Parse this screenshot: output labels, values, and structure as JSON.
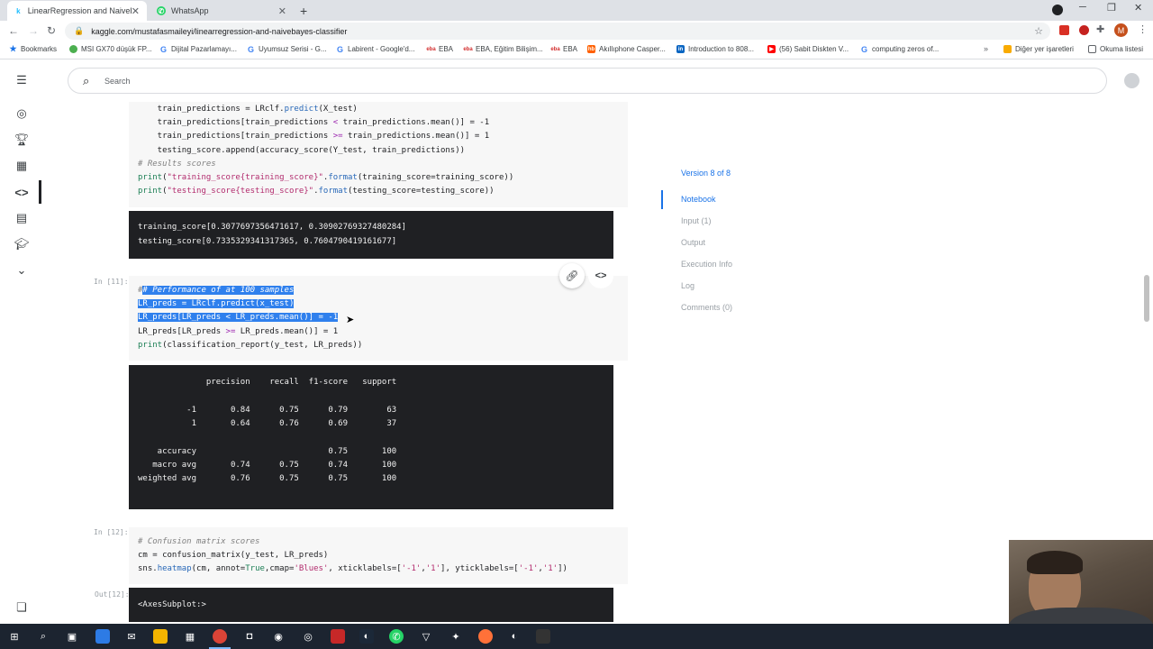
{
  "browser": {
    "tabs": [
      {
        "title": "LinearRegression and NaiveBayes",
        "icon": "kaggle-icon",
        "active": true
      },
      {
        "title": "WhatsApp",
        "icon": "whatsapp-icon",
        "active": false
      }
    ],
    "url": "kaggle.com/mustafasmaileyi/linearregression-and-naivebayes-classifier",
    "bookmarks": [
      {
        "label": "Bookmarks",
        "icon": "star-icon"
      },
      {
        "label": "MSI GX70 düşük FP...",
        "icon": "msi-icon"
      },
      {
        "label": "Dijital Pazarlamayı...",
        "icon": "google-icon"
      },
      {
        "label": "Uyumsuz Serisi - G...",
        "icon": "google-icon"
      },
      {
        "label": "Labirent - Google'd...",
        "icon": "google-icon"
      },
      {
        "label": "EBA",
        "icon": "eba-icon"
      },
      {
        "label": "EBA, Eğitim Bilişim...",
        "icon": "eba-icon"
      },
      {
        "label": "EBA",
        "icon": "eba-icon"
      },
      {
        "label": "Akıllıphone Casper...",
        "icon": "hb-icon"
      },
      {
        "label": "Introduction to 808...",
        "icon": "linkedin-icon"
      },
      {
        "label": "(56) Sabit Diskten V...",
        "icon": "youtube-icon"
      },
      {
        "label": "computing zeros of...",
        "icon": "google-icon"
      }
    ],
    "other_bookmarks": "Diğer yer işaretleri",
    "reading_list": "Okuma listesi",
    "profile_initial": "M"
  },
  "kaggle": {
    "search_placeholder": "Search",
    "cells": {
      "cell10_lines": [
        "    train_predictions = LRclf.predict(X_test)",
        "    train_predictions[train_predictions < train_predictions.mean()] = -1",
        "    train_predictions[train_predictions >= train_predictions.mean()] = 1",
        "    testing_score.append(accuracy_score(Y_test, train_predictions))",
        "# Results scores",
        "print(\"training_score{training_score}\".format(training_score=training_score))",
        "print(\"testing_score{testing_score}\".format(testing_score=testing_score))"
      ],
      "out10_lines": [
        "training_score[0.3077697356471617, 0.30902769327480284]",
        "testing_score[0.7335329341317365, 0.7604790419161677]"
      ],
      "cell11_prompt": "In [11]:",
      "cell11_lines": [
        "# Performance of at 100 samples",
        "LR_preds = LRclf.predict(x_test)",
        "LR_preds[LR_preds < LR_preds.mean()] = -1",
        "LR_preds[LR_preds >= LR_preds.mean()] = 1",
        "print(classification_report(y_test, LR_preds))"
      ],
      "out11_lines": [
        "              precision    recall  f1-score   support",
        "",
        "          -1       0.84      0.75      0.79        63",
        "           1       0.64      0.76      0.69        37",
        "",
        "    accuracy                           0.75       100",
        "   macro avg       0.74      0.75      0.74       100",
        "weighted avg       0.76      0.75      0.75       100"
      ],
      "cell12_prompt": "In [12]:",
      "cell12_lines": [
        "# Confusion matrix scores",
        "cm = confusion_matrix(y_test, LR_preds)",
        "sns.heatmap(cm, annot=True,cmap='Blues', xticklabels=['-1','1'], yticklabels=['-1','1'])"
      ],
      "out12_prompt": "Out[12]:",
      "out12_text": "<AxesSubplot:>"
    },
    "right_nav": {
      "version": "Version 8 of 8",
      "items": [
        "Notebook",
        "Input (1)",
        "Output",
        "Execution Info",
        "Log",
        "Comments (0)"
      ]
    }
  },
  "colors": {
    "kaggle_blue": "#20beff",
    "link_blue": "#1a73e8",
    "selection": "#2f80ed",
    "output_bg": "#1f2023",
    "taskbar": "#1c2430"
  }
}
